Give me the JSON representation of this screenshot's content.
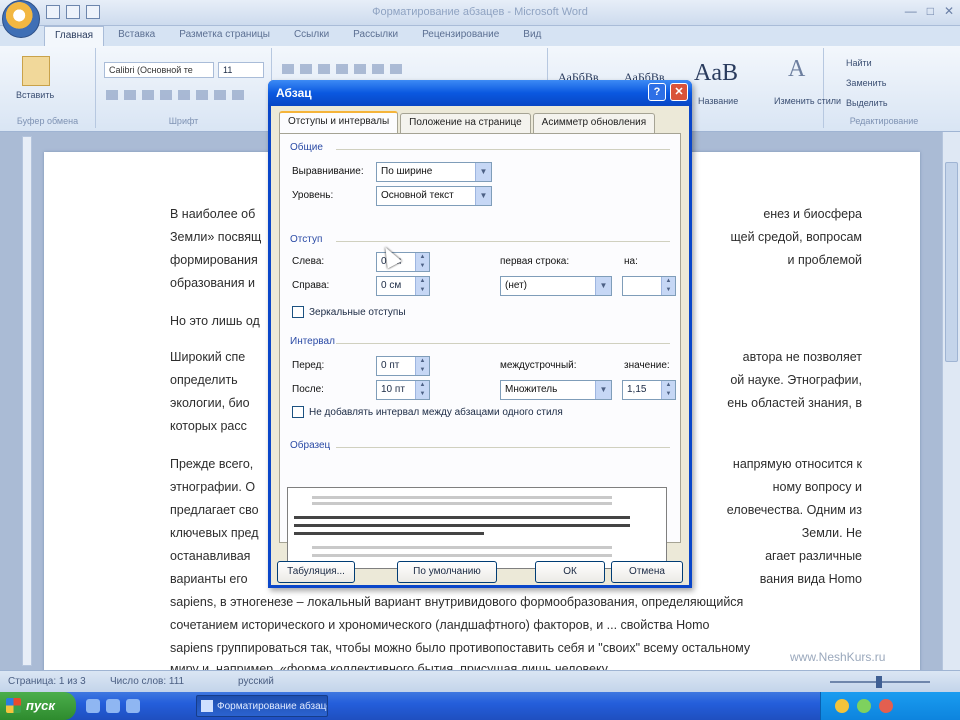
{
  "window": {
    "title": "Форматирование абзацев - Microsoft Word"
  },
  "ribbon": {
    "tabs": [
      "Главная",
      "Вставка",
      "Разметка страницы",
      "Ссылки",
      "Рассылки",
      "Рецензирование",
      "Вид"
    ],
    "font_name": "Calibri (Основной те",
    "font_size": "11",
    "paste_label": "Вставить",
    "clipboard_caption": "Буфер обмена",
    "font_caption": "Шрифт",
    "style_samples": [
      "АаБбВв",
      "АаБбВв",
      "AaB",
      "A"
    ],
    "style_labels": [
      "Название"
    ],
    "change_styles": "Изменить стили",
    "find": "Найти",
    "replace": "Заменить",
    "select": "Выделить",
    "editing_caption": "Редактирование"
  },
  "document": {
    "paragraphs": [
      [
        "В наиболее об",
        "енез и биосфера",
        "Земли» посвящ",
        "щей средой, вопросам",
        "формирования",
        "и проблемой",
        "образования и"
      ],
      [
        "Но это лишь од"
      ],
      [
        "Широкий спе",
        "автора не позволяет",
        "определить",
        "ой науке. Этнографии,",
        "экологии, био",
        "ень областей знания, в",
        "которых расс"
      ],
      [
        "Прежде всего,",
        "напрямую относится к",
        "этнографии. О",
        "ному вопросу и",
        "предлагает сво",
        "еловечества. Одним из",
        "ключевых пред",
        "Земли. Не",
        "останавливая",
        "агает различные",
        "варианты его",
        "вания вида Homo"
      ],
      [
        "sapiens, в этногенезе – локальный вариант внутривидового формообразования, определяющийся"
      ],
      [
        "сочетанием исторического и хрономического (ландшафтного) факторов, и ... свойства Homo"
      ],
      [
        "sapiens группироваться так, чтобы можно было противопоставить себя и \"своих\" всему остальному"
      ],
      [
        "миру и, например, «форма коллективного бытия, присущая лишь человеку"
      ]
    ]
  },
  "watermark": "www.NeshKurs.ru",
  "statusbar": {
    "page": "Страница: 1 из 3",
    "words": "Число слов: 111",
    "lang": "русский"
  },
  "taskbar": {
    "start": "пуск",
    "active_task": "Форматирование абзацев"
  },
  "dialog": {
    "title": "Абзац",
    "tabs": [
      "Отступы и интервалы",
      "Положение на странице",
      "Асимметр обновления"
    ],
    "general": {
      "legend": "Общие",
      "alignment_label": "Выравнивание:",
      "alignment_value": "По ширине",
      "level_label": "Уровень:",
      "level_value": "Основной текст"
    },
    "indent": {
      "legend": "Отступ",
      "left_label": "Слева:",
      "left_value": "0 см",
      "right_label": "Справа:",
      "right_value": "0 см",
      "first_line_label": "первая строка:",
      "first_line_value": "(нет)",
      "by_label": "на:",
      "by_value": "",
      "mirror_label": "Зеркальные отступы"
    },
    "spacing": {
      "legend": "Интервал",
      "before_label": "Перед:",
      "before_value": "0 пт",
      "after_label": "После:",
      "after_value": "10 пт",
      "line_label": "междустрочный:",
      "line_value": "Множитель",
      "at_label": "значение:",
      "at_value": "1,15",
      "no_space_label": "Не добавлять интервал между абзацами одного стиля"
    },
    "preview": {
      "legend": "Образец"
    },
    "buttons": {
      "tabs": "Табуляция...",
      "default": "По умолчанию",
      "ok": "ОК",
      "cancel": "Отмена"
    }
  }
}
